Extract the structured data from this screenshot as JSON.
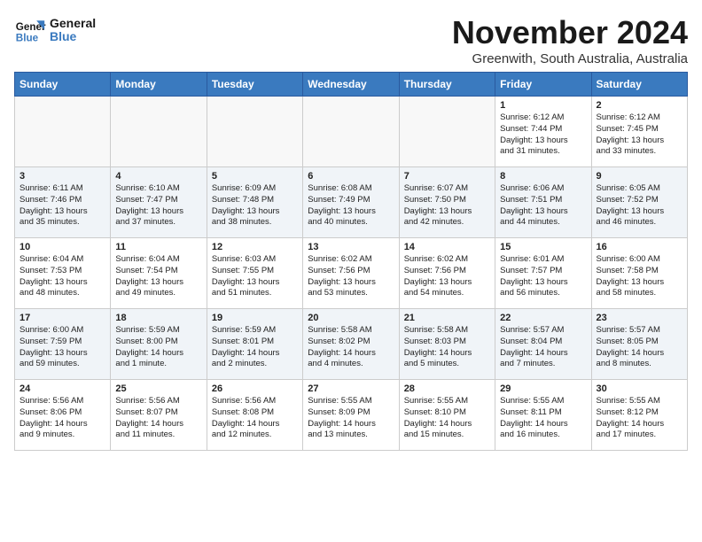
{
  "header": {
    "logo_line1": "General",
    "logo_line2": "Blue",
    "month": "November 2024",
    "location": "Greenwith, South Australia, Australia"
  },
  "weekdays": [
    "Sunday",
    "Monday",
    "Tuesday",
    "Wednesday",
    "Thursday",
    "Friday",
    "Saturday"
  ],
  "weeks": [
    [
      {
        "day": "",
        "info": ""
      },
      {
        "day": "",
        "info": ""
      },
      {
        "day": "",
        "info": ""
      },
      {
        "day": "",
        "info": ""
      },
      {
        "day": "",
        "info": ""
      },
      {
        "day": "1",
        "info": "Sunrise: 6:12 AM\nSunset: 7:44 PM\nDaylight: 13 hours\nand 31 minutes."
      },
      {
        "day": "2",
        "info": "Sunrise: 6:12 AM\nSunset: 7:45 PM\nDaylight: 13 hours\nand 33 minutes."
      }
    ],
    [
      {
        "day": "3",
        "info": "Sunrise: 6:11 AM\nSunset: 7:46 PM\nDaylight: 13 hours\nand 35 minutes."
      },
      {
        "day": "4",
        "info": "Sunrise: 6:10 AM\nSunset: 7:47 PM\nDaylight: 13 hours\nand 37 minutes."
      },
      {
        "day": "5",
        "info": "Sunrise: 6:09 AM\nSunset: 7:48 PM\nDaylight: 13 hours\nand 38 minutes."
      },
      {
        "day": "6",
        "info": "Sunrise: 6:08 AM\nSunset: 7:49 PM\nDaylight: 13 hours\nand 40 minutes."
      },
      {
        "day": "7",
        "info": "Sunrise: 6:07 AM\nSunset: 7:50 PM\nDaylight: 13 hours\nand 42 minutes."
      },
      {
        "day": "8",
        "info": "Sunrise: 6:06 AM\nSunset: 7:51 PM\nDaylight: 13 hours\nand 44 minutes."
      },
      {
        "day": "9",
        "info": "Sunrise: 6:05 AM\nSunset: 7:52 PM\nDaylight: 13 hours\nand 46 minutes."
      }
    ],
    [
      {
        "day": "10",
        "info": "Sunrise: 6:04 AM\nSunset: 7:53 PM\nDaylight: 13 hours\nand 48 minutes."
      },
      {
        "day": "11",
        "info": "Sunrise: 6:04 AM\nSunset: 7:54 PM\nDaylight: 13 hours\nand 49 minutes."
      },
      {
        "day": "12",
        "info": "Sunrise: 6:03 AM\nSunset: 7:55 PM\nDaylight: 13 hours\nand 51 minutes."
      },
      {
        "day": "13",
        "info": "Sunrise: 6:02 AM\nSunset: 7:56 PM\nDaylight: 13 hours\nand 53 minutes."
      },
      {
        "day": "14",
        "info": "Sunrise: 6:02 AM\nSunset: 7:56 PM\nDaylight: 13 hours\nand 54 minutes."
      },
      {
        "day": "15",
        "info": "Sunrise: 6:01 AM\nSunset: 7:57 PM\nDaylight: 13 hours\nand 56 minutes."
      },
      {
        "day": "16",
        "info": "Sunrise: 6:00 AM\nSunset: 7:58 PM\nDaylight: 13 hours\nand 58 minutes."
      }
    ],
    [
      {
        "day": "17",
        "info": "Sunrise: 6:00 AM\nSunset: 7:59 PM\nDaylight: 13 hours\nand 59 minutes."
      },
      {
        "day": "18",
        "info": "Sunrise: 5:59 AM\nSunset: 8:00 PM\nDaylight: 14 hours\nand 1 minute."
      },
      {
        "day": "19",
        "info": "Sunrise: 5:59 AM\nSunset: 8:01 PM\nDaylight: 14 hours\nand 2 minutes."
      },
      {
        "day": "20",
        "info": "Sunrise: 5:58 AM\nSunset: 8:02 PM\nDaylight: 14 hours\nand 4 minutes."
      },
      {
        "day": "21",
        "info": "Sunrise: 5:58 AM\nSunset: 8:03 PM\nDaylight: 14 hours\nand 5 minutes."
      },
      {
        "day": "22",
        "info": "Sunrise: 5:57 AM\nSunset: 8:04 PM\nDaylight: 14 hours\nand 7 minutes."
      },
      {
        "day": "23",
        "info": "Sunrise: 5:57 AM\nSunset: 8:05 PM\nDaylight: 14 hours\nand 8 minutes."
      }
    ],
    [
      {
        "day": "24",
        "info": "Sunrise: 5:56 AM\nSunset: 8:06 PM\nDaylight: 14 hours\nand 9 minutes."
      },
      {
        "day": "25",
        "info": "Sunrise: 5:56 AM\nSunset: 8:07 PM\nDaylight: 14 hours\nand 11 minutes."
      },
      {
        "day": "26",
        "info": "Sunrise: 5:56 AM\nSunset: 8:08 PM\nDaylight: 14 hours\nand 12 minutes."
      },
      {
        "day": "27",
        "info": "Sunrise: 5:55 AM\nSunset: 8:09 PM\nDaylight: 14 hours\nand 13 minutes."
      },
      {
        "day": "28",
        "info": "Sunrise: 5:55 AM\nSunset: 8:10 PM\nDaylight: 14 hours\nand 15 minutes."
      },
      {
        "day": "29",
        "info": "Sunrise: 5:55 AM\nSunset: 8:11 PM\nDaylight: 14 hours\nand 16 minutes."
      },
      {
        "day": "30",
        "info": "Sunrise: 5:55 AM\nSunset: 8:12 PM\nDaylight: 14 hours\nand 17 minutes."
      }
    ]
  ]
}
